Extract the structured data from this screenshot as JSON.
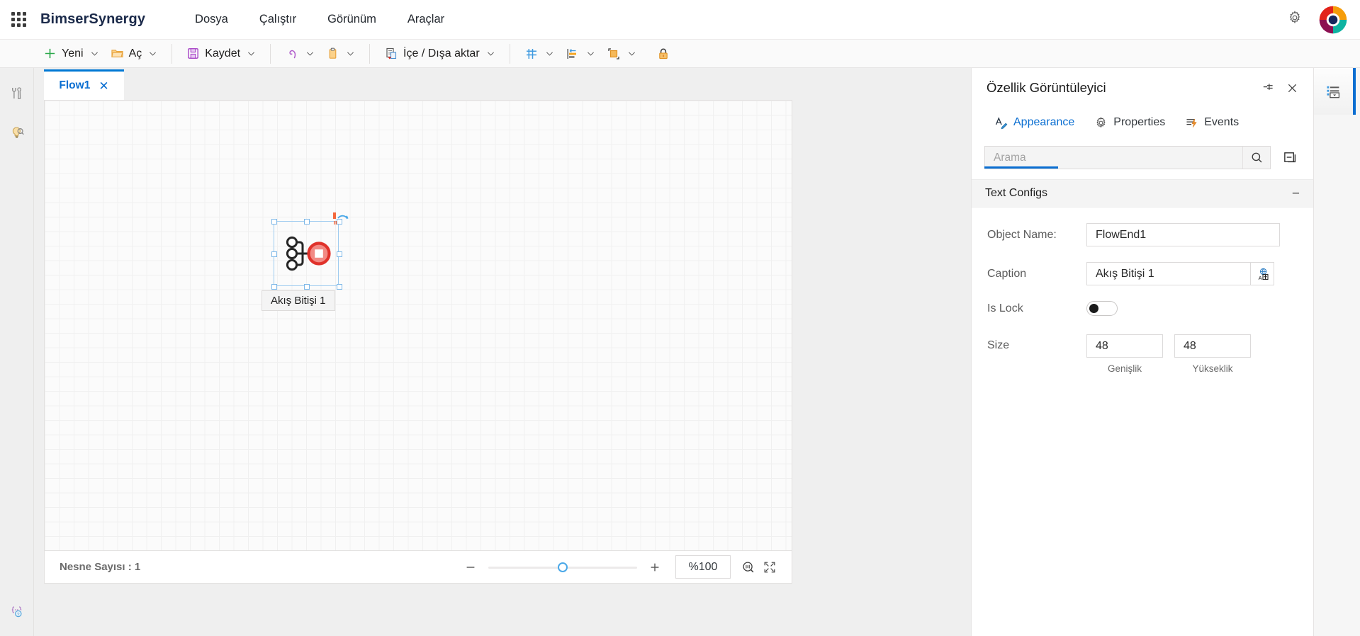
{
  "app": {
    "brand": "BimserSynergy",
    "waffle_icon": "app-grid-icon",
    "gear_icon": "gear-icon",
    "avatar_icon": "user-avatar-donut-logo"
  },
  "menubar": {
    "items": [
      {
        "label": "Dosya"
      },
      {
        "label": "Çalıştır"
      },
      {
        "label": "Görünüm"
      },
      {
        "label": "Araçlar"
      }
    ]
  },
  "toolbar": {
    "groups": [
      {
        "buttons": [
          {
            "label": "Yeni",
            "icon": "plus-icon",
            "caret": true
          },
          {
            "label": "Aç",
            "icon": "folder-open-icon",
            "caret": true
          }
        ]
      },
      {
        "buttons": [
          {
            "label": "Kaydet",
            "icon": "save-floppy-icon",
            "caret": true
          }
        ]
      },
      {
        "buttons": [
          {
            "label": "",
            "icon": "undo-icon",
            "caret": true
          },
          {
            "label": "",
            "icon": "clipboard-paste-icon",
            "caret": true
          }
        ]
      },
      {
        "buttons": [
          {
            "label": "İçe / Dışa aktar",
            "icon": "import-export-icon",
            "caret": true
          }
        ]
      },
      {
        "buttons": [
          {
            "label": "",
            "icon": "grid-icon",
            "caret": true
          },
          {
            "label": "",
            "icon": "align-left-icon",
            "caret": true
          },
          {
            "label": "",
            "icon": "group-shapes-icon",
            "caret": true
          },
          {
            "label": "",
            "icon": "lock-icon",
            "caret": false
          }
        ]
      }
    ]
  },
  "left_rail": {
    "items": [
      {
        "icon": "tools-wrench-screwdriver-icon",
        "name": "toolbox"
      },
      {
        "icon": "lightbulb-search-icon",
        "name": "insights"
      }
    ],
    "bottom": {
      "icon": "code-braces-help-icon",
      "name": "script-help"
    }
  },
  "workspace": {
    "tabs": [
      {
        "label": "Flow1",
        "close_icon": "close-icon",
        "active": true
      }
    ],
    "node": {
      "caption": "Akış Bitişi 1",
      "shape": "flow-end-node",
      "rotate_icon": "rotate-handle-icon"
    },
    "footer": {
      "object_count_label": "Nesne Sayısı : 1",
      "zoom_out_icon": "minus-icon",
      "zoom_in_icon": "plus-icon",
      "zoom_value": "%100",
      "zoom_reset_icon": "zoom-fit-icon",
      "fullscreen_icon": "expand-icon"
    }
  },
  "property_panel": {
    "title": "Özellik Görüntüleyici",
    "pin_icon": "pin-icon",
    "close_icon": "close-icon",
    "tabs": [
      {
        "label": "Appearance",
        "icon": "appearance-pen-icon",
        "active": true
      },
      {
        "label": "Properties",
        "icon": "gear-icon",
        "active": false
      },
      {
        "label": "Events",
        "icon": "events-lightning-icon",
        "active": false
      }
    ],
    "search": {
      "placeholder": "Arama",
      "value": "",
      "search_icon": "search-icon"
    },
    "collapse_all_icon": "collapse-all-icon",
    "section": {
      "title": "Text Configs",
      "toggle": "−"
    },
    "fields": {
      "object_name": {
        "label": "Object Name:",
        "value": "FlowEnd1"
      },
      "caption": {
        "label": "Caption",
        "value": "Akış Bitişi 1",
        "lang_icon": "translate-icon"
      },
      "is_lock": {
        "label": "Is Lock",
        "value": "off"
      },
      "size": {
        "label": "Size",
        "width_value": "48",
        "width_sub": "Genişlik",
        "height_value": "48",
        "height_sub": "Yükseklik"
      }
    }
  },
  "right_rail": {
    "items": [
      {
        "icon": "properties-list-icon",
        "name": "property-viewer-toggle"
      }
    ]
  },
  "colors": {
    "accent": "#0a6ed1",
    "node_red": "#e03b34",
    "node_red_fill": "#f2857f",
    "toolbar_bg": "#fafafa",
    "rail_bg": "#efefef"
  }
}
